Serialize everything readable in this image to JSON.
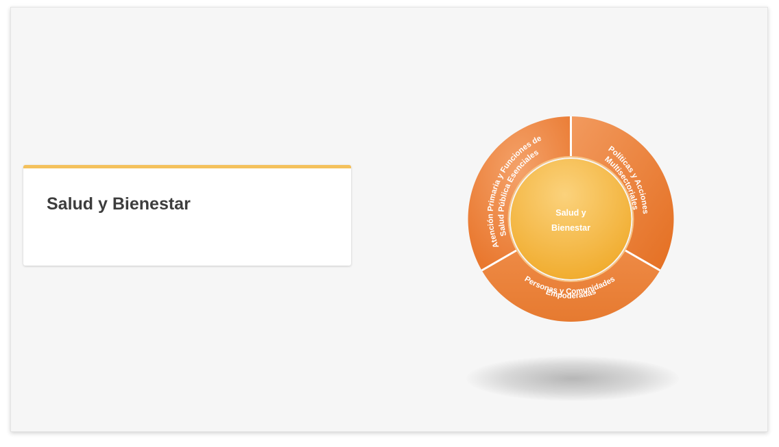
{
  "card": {
    "title": "Salud y Bienestar"
  },
  "wheel": {
    "center_label_line1": "Salud y",
    "center_label_line2": "Bienestar",
    "segments": [
      {
        "line1": "Atención Primaria y Funciones de",
        "line2": "Salud Pública Esenciales"
      },
      {
        "line1": "Políticas y Acciones",
        "line2": "Multisectoriales"
      },
      {
        "line1": "Personas y Comunidades",
        "line2": "Empoderadas"
      }
    ]
  },
  "colors": {
    "background": "#f6f6f6",
    "card_accent": "#f4c15c",
    "segment_orange": "#ee8a45",
    "center_gold": "#f6b84a",
    "title_text": "#3d3d3d"
  }
}
